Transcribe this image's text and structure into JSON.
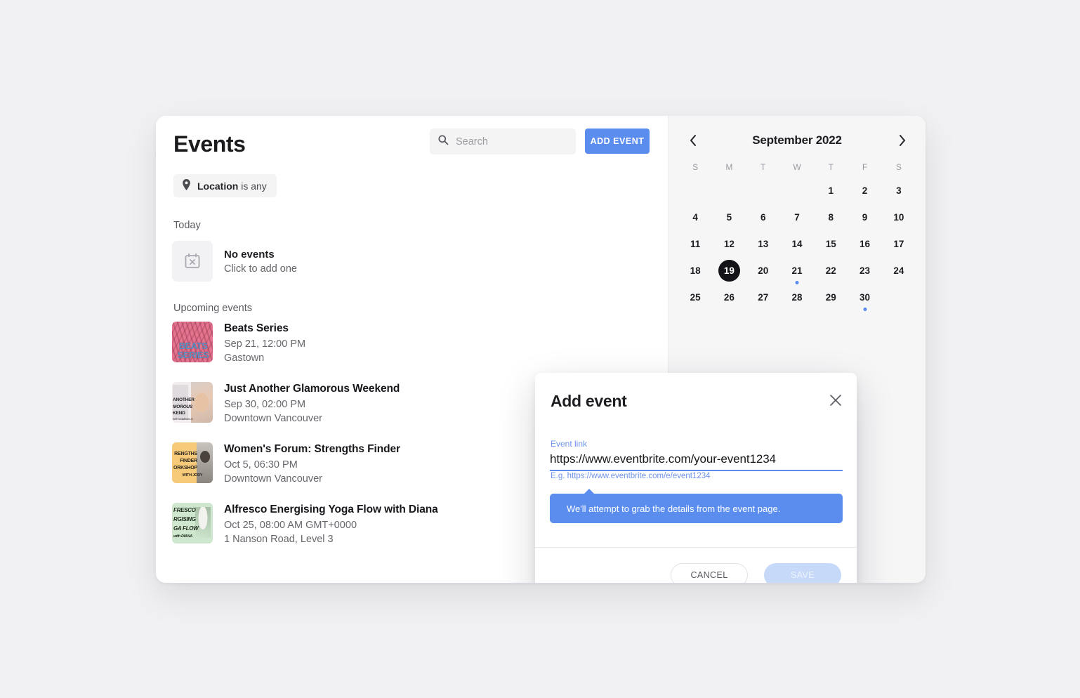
{
  "app": {
    "title": "Events"
  },
  "search": {
    "placeholder": "Search",
    "value": "",
    "icon": "search-icon"
  },
  "toolbar": {
    "add_event_label": "ADD EVENT"
  },
  "filters": {
    "location_chip": {
      "icon": "location-pin-icon",
      "bold_label": "Location",
      "rest_label": " is any"
    }
  },
  "sections": {
    "today_label": "Today",
    "upcoming_label": "Upcoming events"
  },
  "today": {
    "icon": "calendar-x-icon",
    "title": "No events",
    "subtitle": "Click to add one"
  },
  "events": [
    {
      "title": "Beats Series",
      "when": "Sep 21, 12:00 PM",
      "where": "Gastown",
      "thumb_style": "beats",
      "thumb_color": "#e5758f",
      "thumb_text": [
        "BEATS",
        "SERIES"
      ]
    },
    {
      "title": "Just Another Glamorous Weekend",
      "when": "Sep 30, 02:00 PM",
      "where": "Downtown Vancouver",
      "thumb_style": "glam",
      "thumb_color": "#f2ecef",
      "thumb_text": [
        "ANOTHER",
        "MOROUS",
        "KEND",
        "WITH MARCELO"
      ]
    },
    {
      "title": "Women's Forum: Strengths Finder",
      "when": "Oct 5, 06:30 PM",
      "where": "Downtown Vancouver",
      "thumb_style": "strengths",
      "thumb_color": "#f6ca78",
      "thumb_text": [
        "RENGTHS",
        "FINDER",
        "ORKSHOP",
        "WITH JODY"
      ]
    },
    {
      "title": "Alfresco Energising Yoga Flow with Diana",
      "when": "Oct 25, 08:00 AM GMT+0000",
      "where": "1 Nanson Road, Level 3",
      "thumb_style": "yoga",
      "thumb_color": "#cfe7cf",
      "thumb_text": [
        "FRESCO",
        "RGISING",
        "GA FLOW",
        "with DIANA"
      ],
      "has_menu": true,
      "menu_icon": "more-vertical-icon"
    }
  ],
  "calendar": {
    "title": "September 2022",
    "prev_icon": "chevron-left-icon",
    "next_icon": "chevron-right-icon",
    "day_headers": [
      "S",
      "M",
      "T",
      "W",
      "T",
      "F",
      "S"
    ],
    "leading_blanks": 4,
    "days": [
      {
        "n": 1
      },
      {
        "n": 2
      },
      {
        "n": 3
      },
      {
        "n": 4
      },
      {
        "n": 5
      },
      {
        "n": 6
      },
      {
        "n": 7
      },
      {
        "n": 8
      },
      {
        "n": 9
      },
      {
        "n": 10
      },
      {
        "n": 11
      },
      {
        "n": 12
      },
      {
        "n": 13
      },
      {
        "n": 14
      },
      {
        "n": 15
      },
      {
        "n": 16
      },
      {
        "n": 17
      },
      {
        "n": 18
      },
      {
        "n": 19,
        "today": true
      },
      {
        "n": 20
      },
      {
        "n": 21,
        "dot": true
      },
      {
        "n": 22
      },
      {
        "n": 23
      },
      {
        "n": 24
      },
      {
        "n": 25
      },
      {
        "n": 26
      },
      {
        "n": 27
      },
      {
        "n": 28
      },
      {
        "n": 29
      },
      {
        "n": 30,
        "dot": true
      }
    ],
    "today_number": 19,
    "event_dot_color": "#5b8def"
  },
  "modal": {
    "title": "Add event",
    "close_icon": "close-icon",
    "field_label": "Event link",
    "field_value": "https://www.eventbrite.com/your-event1234",
    "field_hint": "E.g. https://www.eventbrite.com/e/event1234",
    "tooltip": "We'll attempt to grab the details from the event page.",
    "cancel_label": "CANCEL",
    "save_label": "SAVE"
  },
  "colors": {
    "accent": "#5b8def",
    "page_bg": "#f1f1f3",
    "panel_bg": "#f6f6f7",
    "today_bg": "#141418"
  }
}
